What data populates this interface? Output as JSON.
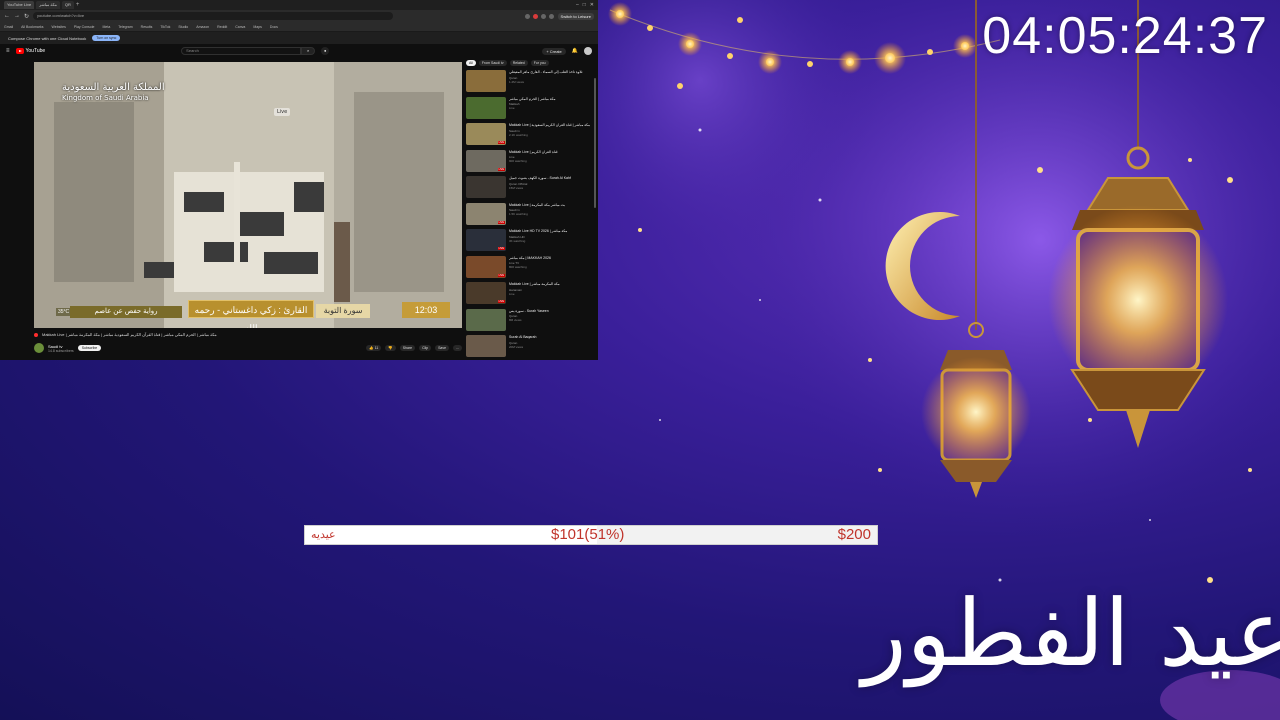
{
  "stream": {
    "countdown": "04:05:24:37",
    "eid_title": "عيد الفطور",
    "goal": {
      "name": "عيديه",
      "current": "$101(51%)",
      "target": "$200",
      "progress": 0.51
    },
    "colors": {
      "background": "#2a1a8a",
      "goal_text": "#c0342b",
      "lantern_glow": "#ffd36b"
    }
  },
  "browser": {
    "tabs": [
      "YouTube Live",
      "مكة مباشر",
      "QR"
    ],
    "url": "youtube.com/watch?v=live",
    "profile_label": "Switch to Leisure",
    "bookmarks": [
      "Gmail",
      "All Bookmarks",
      "Websites",
      "Play Console",
      "Meta",
      "Telegram",
      "Results",
      "TikTok",
      "Studio",
      "Amazon",
      "Reddit",
      "Canva",
      "Maps",
      "Docs"
    ],
    "infobar": {
      "text": "Compose Chrome with one Cloud Notebook",
      "button": "Turn on sync"
    }
  },
  "youtube": {
    "logo_text": "YouTube",
    "search_placeholder": "Search",
    "create_label": "+ Create",
    "player": {
      "ksa_ar": "المملكة العربية السعودية",
      "ksa_en": "Kingdom of Saudi Arabia",
      "live_badge": "Live",
      "temperature": "35°C",
      "riwaya": "رواية حفص عن عاصم",
      "qari": "القارئ : زكي داغستاني - رحمه الله",
      "surah": "سورة التوبة",
      "time": "12:03"
    },
    "video_title": "Makkah Live | مكة مباشر | الحرم المكي مباشر | قناة القرآن الكريم السعودية مباشر | مكة المكرمة مباشر",
    "channel": {
      "name": "Saudi tv",
      "subs": "14.8 subscribers",
      "subscribe": "Subscribe"
    },
    "actions": [
      "👍 11",
      "👎",
      "Share",
      "Clip",
      "Save",
      "..."
    ],
    "chips": [
      "All",
      "From Saudi tv",
      "Related",
      "For you"
    ],
    "recommendations": [
      {
        "title": "تلاوة تأخذ القلب إلى السماء - القارئ ماهر المعيقلي",
        "channel": "Quran",
        "stats": "1.2M views",
        "thumb": "#8a6d3b",
        "live": false
      },
      {
        "title": "مكة مباشر | الحرم المكي مباشر",
        "channel": "Makkah",
        "stats": "Live",
        "thumb": "#4b6b2f",
        "live": false
      },
      {
        "title": "Makkah Live | مكة مباشر | قناة القرآن الكريم السعودية",
        "channel": "Saudi tv",
        "stats": "2.1K watching",
        "thumb": "#9a8a5a",
        "live": true
      },
      {
        "title": "Makkah Live | قناة القرآن الكريم",
        "channel": "Live",
        "stats": "900 watching",
        "thumb": "#6e6a60",
        "live": true
      },
      {
        "title": "سورة الكهف بصوت جميل - Surah Al Kahf",
        "channel": "Quran Official",
        "stats": "15M views",
        "thumb": "#3a3530",
        "live": false
      },
      {
        "title": "Makkah Live | بث مباشر مكة المكرمة",
        "channel": "Saudi tv",
        "stats": "1.5K watching",
        "thumb": "#8c8470",
        "live": true
      },
      {
        "title": "Makkah Live HD TV 2026 | مكة مباشر",
        "channel": "Makkah HD",
        "stats": "3K watching",
        "thumb": "#2a2f3a",
        "live": true
      },
      {
        "title": "مكة مباشر | MAKKAH 2026",
        "channel": "Live TV",
        "stats": "800 watching",
        "thumb": "#7a4a2a",
        "live": true
      },
      {
        "title": "Makkah Live | مكة المكرمة مباشر",
        "channel": "Haramain",
        "stats": "Live",
        "thumb": "#4a3a2a",
        "live": true
      },
      {
        "title": "سورة يس - Surah Yaseen",
        "channel": "Quran",
        "stats": "8M views",
        "thumb": "#5a6a4a",
        "live": false
      },
      {
        "title": "Surah Al Baqarah",
        "channel": "Quran",
        "stats": "20M views",
        "thumb": "#6a5a4a",
        "live": false
      },
      {
        "title": "Makkah Live | مكة مباشر",
        "channel": "Saudi",
        "stats": "Live",
        "thumb": "#3a3a3a",
        "live": true
      }
    ]
  }
}
